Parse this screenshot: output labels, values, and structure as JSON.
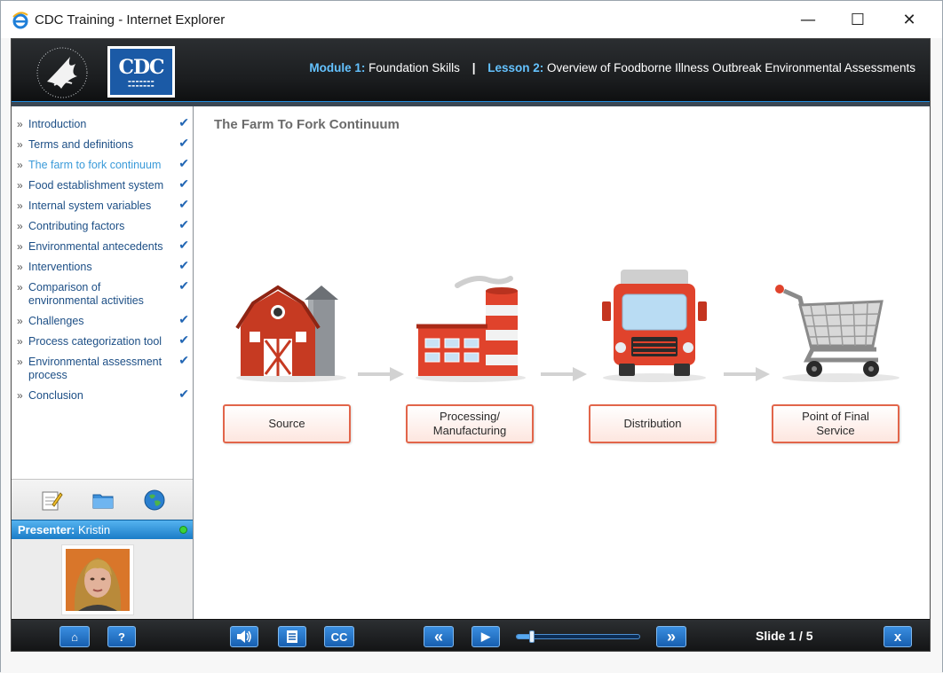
{
  "window": {
    "title": "CDC Training - Internet Explorer",
    "minimize": "—",
    "maximize": "☐",
    "close": "✕"
  },
  "header": {
    "cdc_logo_text": "CDC",
    "module_label": "Module 1:",
    "module_name": "Foundation Skills",
    "separator": "|",
    "lesson_label": "Lesson 2:",
    "lesson_name": "Overview of Foodborne Illness Outbreak Environmental Assessments"
  },
  "sidebar": {
    "items": [
      {
        "label": "Introduction",
        "completed": true
      },
      {
        "label": "Terms and definitions",
        "completed": true
      },
      {
        "label": "The farm to fork continuum",
        "completed": true,
        "active": true
      },
      {
        "label": "Food establishment system",
        "completed": true
      },
      {
        "label": "Internal system variables",
        "completed": true
      },
      {
        "label": "Contributing factors",
        "completed": true
      },
      {
        "label": "Environmental antecedents",
        "completed": true
      },
      {
        "label": "Interventions",
        "completed": true
      },
      {
        "label": "Comparison of environmental activities",
        "completed": true
      },
      {
        "label": "Challenges",
        "completed": true
      },
      {
        "label": "Process categorization tool",
        "completed": true
      },
      {
        "label": "Environmental assessment process",
        "completed": true
      },
      {
        "label": "Conclusion",
        "completed": true
      }
    ],
    "bullet": "»",
    "check": "✔",
    "tools": [
      "notes-icon",
      "folder-icon",
      "globe-icon"
    ],
    "presenter_label": "Presenter:",
    "presenter_name": "Kristin",
    "presenter_status_color": "#3bd23b"
  },
  "slide": {
    "title": "The Farm To Fork Continuum",
    "steps": [
      {
        "label": "Source",
        "icon": "barn-icon"
      },
      {
        "label": "Processing/\nManufacturing",
        "icon": "factory-icon"
      },
      {
        "label": "Distribution",
        "icon": "truck-icon"
      },
      {
        "label": "Point of Final\nService",
        "icon": "shopping-cart-icon"
      }
    ],
    "accent_color": "#e2654a"
  },
  "controls": {
    "home_label": "⌂",
    "help_label": "?",
    "cc_label": "CC",
    "rewind_label": "«",
    "play_label": "▶",
    "forward_label": "»",
    "exit_label": "x",
    "progress_fraction": 0.12,
    "slide_counter": "Slide 1 / 5"
  }
}
